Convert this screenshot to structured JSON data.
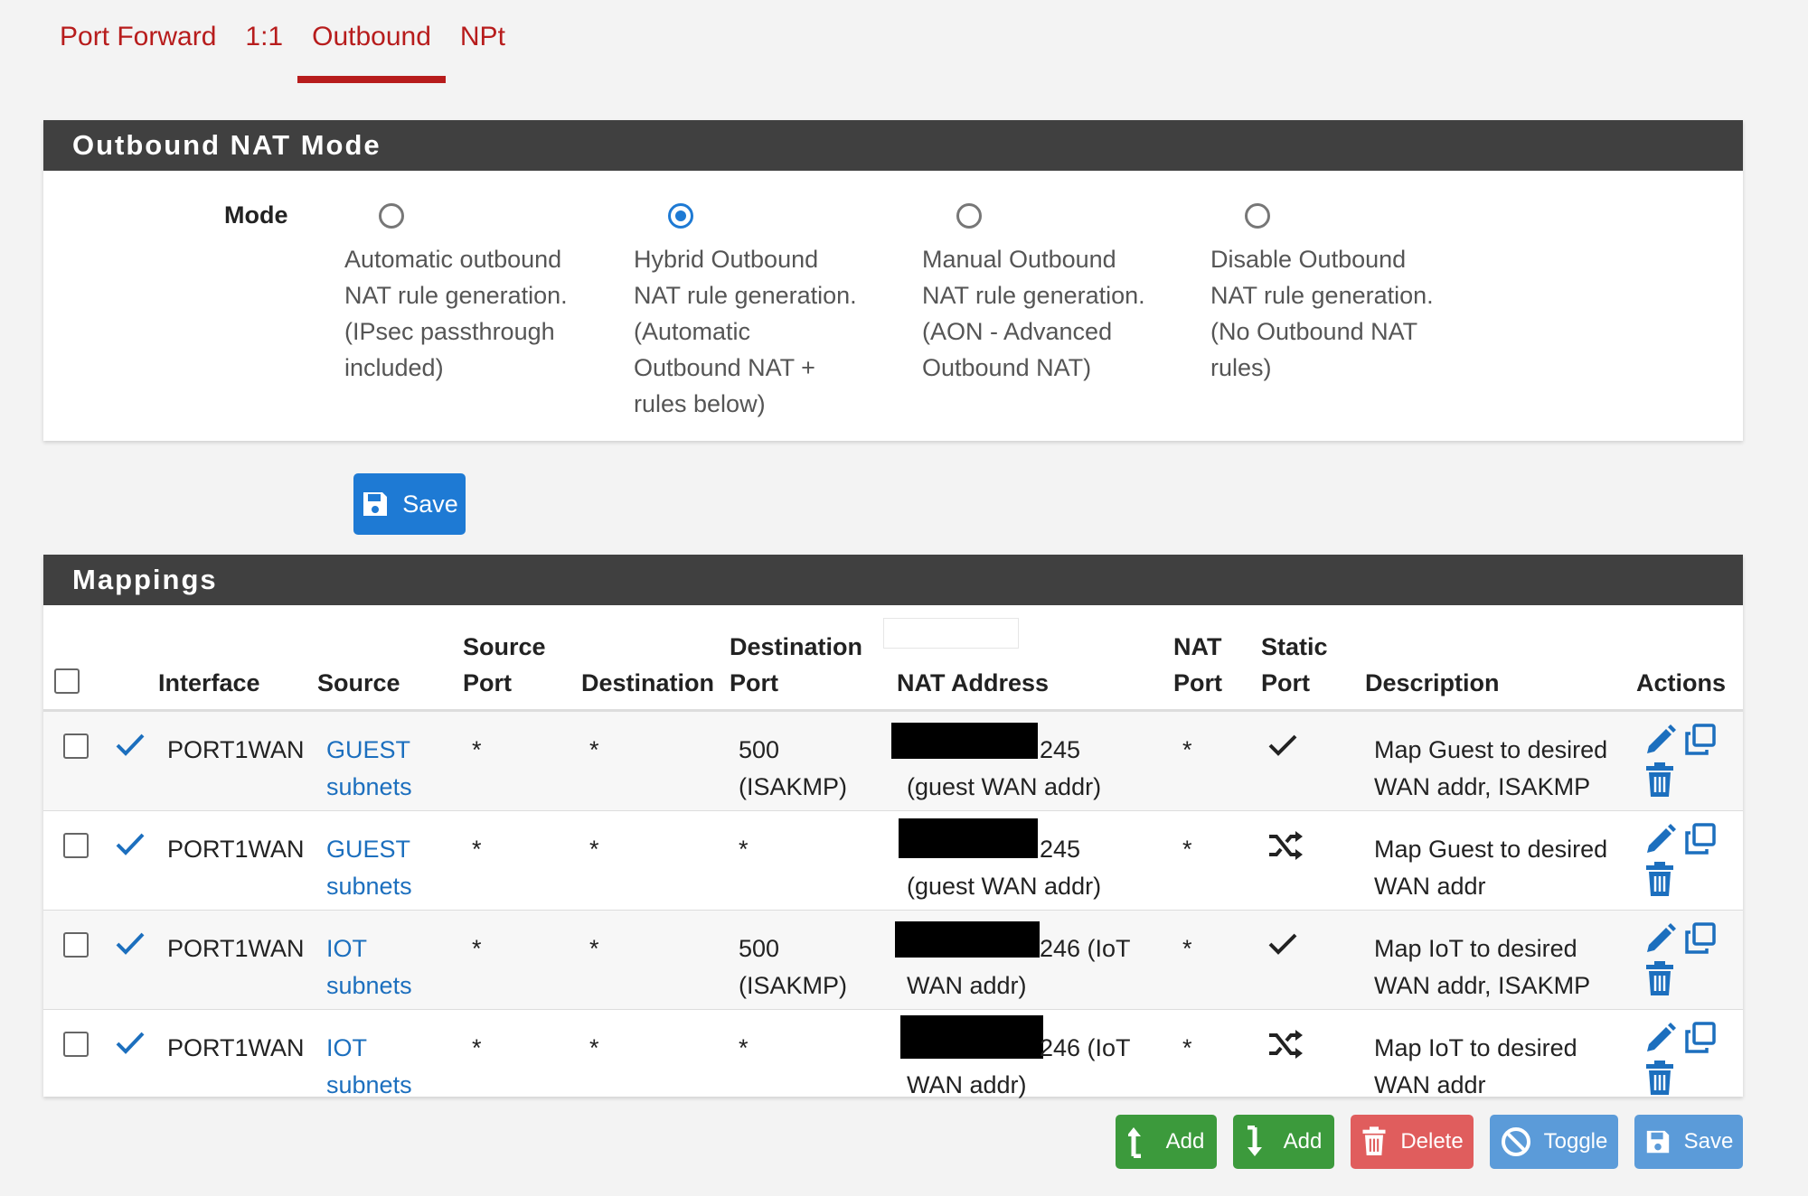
{
  "tabs": [
    {
      "label": "Port Forward",
      "active": false
    },
    {
      "label": "1:1",
      "active": false
    },
    {
      "label": "Outbound",
      "active": true
    },
    {
      "label": "NPt",
      "active": false
    }
  ],
  "mode_panel": {
    "title": "Outbound NAT Mode",
    "mode_label": "Mode",
    "options": [
      {
        "text": "Automatic outbound NAT rule generation. (IPsec passthrough included)",
        "lines": [
          "Automatic outbound",
          "NAT rule generation.",
          "(IPsec passthrough",
          "included)"
        ],
        "checked": false
      },
      {
        "text": "Hybrid Outbound NAT rule generation. (Automatic Outbound NAT + rules below)",
        "lines": [
          "Hybrid Outbound",
          "NAT rule generation.",
          "(Automatic",
          "Outbound NAT +",
          "rules below)"
        ],
        "checked": true
      },
      {
        "text": "Manual Outbound NAT rule generation. (AON - Advanced Outbound NAT)",
        "lines": [
          "Manual Outbound",
          "NAT rule generation.",
          "(AON - Advanced",
          "Outbound NAT)"
        ],
        "checked": false
      },
      {
        "text": "Disable Outbound NAT rule generation. (No Outbound NAT rules)",
        "lines": [
          "Disable Outbound",
          "NAT rule generation.",
          "(No Outbound NAT",
          "rules)"
        ],
        "checked": false
      }
    ],
    "save_label": "Save"
  },
  "mappings": {
    "title": "Mappings",
    "headers": {
      "interface": "Interface",
      "source": "Source",
      "source_port_1": "Source",
      "source_port_2": "Port",
      "destination": "Destination",
      "destination_port_1": "Destination",
      "destination_port_2": "Port",
      "nat_address": "NAT Address",
      "nat_port_1": "NAT",
      "nat_port_2": "Port",
      "static_port_1": "Static",
      "static_port_2": "Port",
      "description": "Description",
      "actions": "Actions"
    },
    "rows": [
      {
        "interface": "PORT1WAN",
        "source_1": "GUEST",
        "source_2": "subnets",
        "source_port": "*",
        "destination": "*",
        "dest_port_1": "500",
        "dest_port_2": "(ISAKMP)",
        "nat_addr_1": "245",
        "nat_addr_2": "(guest WAN addr)",
        "nat_port": "*",
        "static": "check",
        "desc_1": "Map Guest to desired",
        "desc_2": "WAN addr, ISAKMP"
      },
      {
        "interface": "PORT1WAN",
        "source_1": "GUEST",
        "source_2": "subnets",
        "source_port": "*",
        "destination": "*",
        "dest_port_1": "*",
        "dest_port_2": "",
        "nat_addr_1": "245",
        "nat_addr_2": "(guest WAN addr)",
        "nat_port": "*",
        "static": "shuffle",
        "desc_1": "Map Guest to desired",
        "desc_2": "WAN addr"
      },
      {
        "interface": "PORT1WAN",
        "source_1": "IOT",
        "source_2": "subnets",
        "source_port": "*",
        "destination": "*",
        "dest_port_1": "500",
        "dest_port_2": "(ISAKMP)",
        "nat_addr_1": "246 (IoT",
        "nat_addr_2": "WAN addr)",
        "nat_port": "*",
        "static": "check",
        "desc_1": "Map IoT to desired",
        "desc_2": "WAN addr, ISAKMP"
      },
      {
        "interface": "PORT1WAN",
        "source_1": "IOT",
        "source_2": "subnets",
        "source_port": "*",
        "destination": "*",
        "dest_port_1": "*",
        "dest_port_2": "",
        "nat_addr_1": "246 (IoT",
        "nat_addr_2": "WAN addr)",
        "nat_port": "*",
        "static": "shuffle",
        "desc_1": "Map IoT to desired",
        "desc_2": "WAN addr"
      }
    ]
  },
  "footer_buttons": {
    "add_top": "Add",
    "add_bottom": "Add",
    "delete": "Delete",
    "toggle": "Toggle",
    "save": "Save"
  },
  "colors": {
    "accent_red": "#b71c1c",
    "primary_blue": "#1e7ad4",
    "success_green": "#3c9a3c",
    "danger_red": "#e05d5d",
    "info_blue": "#5b9bd9",
    "heading_dark": "#404040"
  }
}
